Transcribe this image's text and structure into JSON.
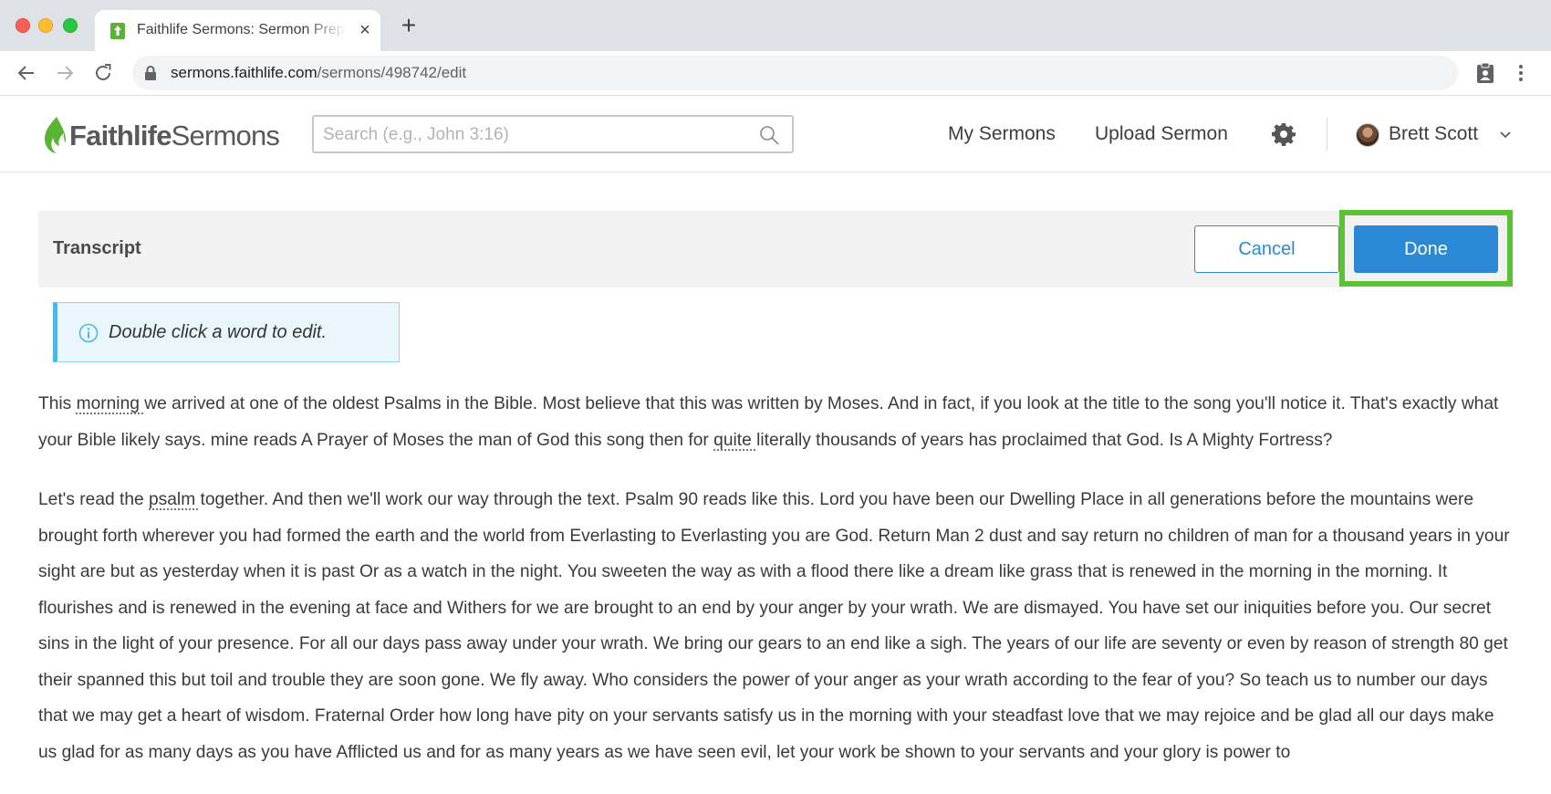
{
  "browser": {
    "tab_title": "Faithlife Sermons: Sermon Preparation",
    "tab_close": "×",
    "new_tab": "+",
    "url_host": "sermons.faithlife.com",
    "url_path": "/sermons/498742/edit"
  },
  "header": {
    "logo_bold": "Faithlife",
    "logo_light": "Sermons",
    "search_placeholder": "Search (e.g., John 3:16)",
    "nav": {
      "my_sermons": "My Sermons",
      "upload_sermon": "Upload Sermon"
    },
    "user_name": "Brett Scott"
  },
  "panel": {
    "title": "Transcript",
    "cancel_label": "Cancel",
    "done_label": "Done",
    "info_text": "Double click a word to edit."
  },
  "transcript": {
    "p1": [
      {
        "t": "This "
      },
      {
        "t": "morning ",
        "edited": true
      },
      {
        "t": "we arrived at one of the oldest Psalms in the Bible. Most believe that this was written by Moses. And in fact, if you look at the title to the song you'll notice it. That's exactly what your Bible likely says. mine reads A Prayer of Moses the man of God this song then for "
      },
      {
        "t": "quite ",
        "edited": true
      },
      {
        "t": "literally thousands of years has proclaimed that God. Is A Mighty Fortress?"
      }
    ],
    "p2": [
      {
        "t": "Let's read the "
      },
      {
        "t": "psalm ",
        "edited": true
      },
      {
        "t": "together. And then we'll work our way through the text. Psalm 90 reads like this. Lord you have been our Dwelling Place in all generations before the mountains were brought forth wherever you had formed the earth and the world from Everlasting to Everlasting you are God. Return Man 2 dust and say return no children of man for a thousand years in your sight are but as yesterday when it is past Or as a watch in the night. You sweeten the way as with a flood there like a dream like grass that is renewed in the morning in the morning. It flourishes and is renewed in the evening at face and Withers for we are brought to an end by your anger by your wrath. We are dismayed. You have set our iniquities before you. Our secret sins in the light of your presence. For all our days pass away under your wrath. We bring our gears to an end like a sigh. The years of our life are seventy or even by reason of strength 80 get their spanned this but toil and trouble they are soon gone. We fly away. Who considers the power of your anger as your wrath according to the fear of you? So teach us to number our days that we may get a heart of wisdom. Fraternal Order how long have pity on your servants satisfy us in the morning with your steadfast love that we may rejoice and be glad all our days make us glad for as many days as you have Afflicted us and for as many years as we have seen evil, let your work be shown to your servants and your glory is power to"
      }
    ]
  },
  "colors": {
    "primary_blue": "#2a88d4",
    "highlight_green": "#5ec035",
    "info_bg": "#e9f6fc",
    "logo_green": "#5bb336"
  }
}
